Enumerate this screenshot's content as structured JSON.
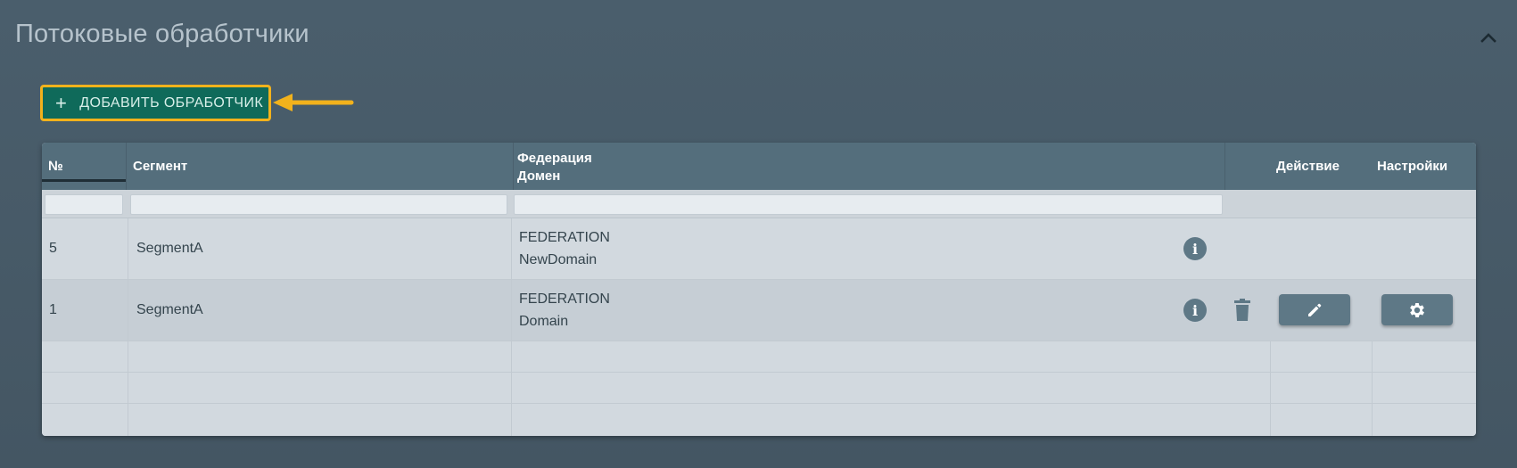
{
  "section": {
    "title": "Потоковые обработчики"
  },
  "toolbar": {
    "add_label": "ДОБАВИТЬ ОБРАБОТЧИК",
    "add_icon": "plus-icon",
    "highlight_color": "#f2b21c",
    "button_color": "#0f6a5a"
  },
  "table": {
    "columns": {
      "number": "№",
      "segment": "Сегмент",
      "federation": "Федерация",
      "domain": "Домен",
      "action": "Действие",
      "settings": "Настройки"
    },
    "rows": [
      {
        "number": "5",
        "segment": "SegmentA",
        "federation": "FEDERATION",
        "domain": "NewDomain"
      },
      {
        "number": "1",
        "segment": "SegmentA",
        "federation": "FEDERATION",
        "domain": "Domain"
      }
    ],
    "header_color": "#546e7c"
  }
}
